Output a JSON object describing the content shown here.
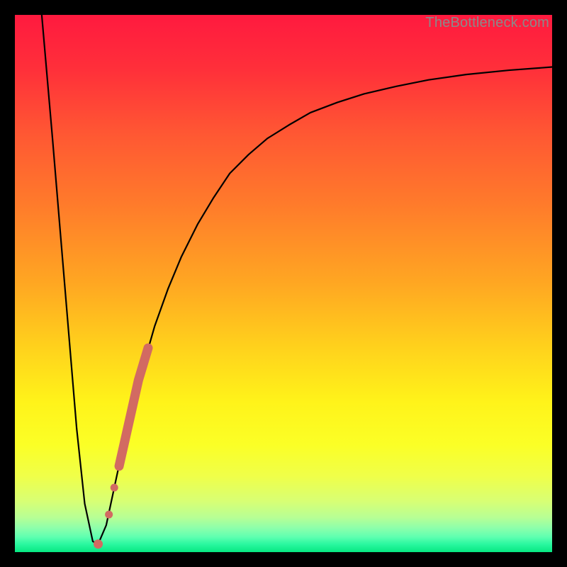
{
  "watermark": "TheBottleneck.com",
  "colors": {
    "frame": "#000000",
    "curve": "#000000",
    "markers": "#d26a62"
  },
  "gradient_stops": [
    {
      "offset": 0.0,
      "color": "#ff1a3f"
    },
    {
      "offset": 0.1,
      "color": "#ff2f3a"
    },
    {
      "offset": 0.22,
      "color": "#ff5733"
    },
    {
      "offset": 0.35,
      "color": "#ff7a2b"
    },
    {
      "offset": 0.5,
      "color": "#ffa722"
    },
    {
      "offset": 0.62,
      "color": "#ffd21c"
    },
    {
      "offset": 0.72,
      "color": "#fff31a"
    },
    {
      "offset": 0.8,
      "color": "#fbff26"
    },
    {
      "offset": 0.86,
      "color": "#efff4a"
    },
    {
      "offset": 0.905,
      "color": "#d8ff74"
    },
    {
      "offset": 0.935,
      "color": "#b8ff94"
    },
    {
      "offset": 0.955,
      "color": "#8dffab"
    },
    {
      "offset": 0.972,
      "color": "#5effb0"
    },
    {
      "offset": 0.985,
      "color": "#2bf8a0"
    },
    {
      "offset": 1.0,
      "color": "#06e882"
    }
  ],
  "chart_data": {
    "type": "line",
    "title": "",
    "xlabel": "",
    "ylabel": "",
    "xlim": [
      0,
      100
    ],
    "ylim": [
      0,
      100
    ],
    "series": [
      {
        "name": "bottleneck-curve",
        "x": [
          5,
          7,
          8.5,
          10,
          11.5,
          13,
          14.5,
          15.5,
          17,
          18.5,
          20,
          22,
          24,
          26,
          28.5,
          31,
          34,
          37,
          40,
          43.5,
          47,
          51,
          55,
          60,
          65,
          71,
          77,
          84,
          92,
          100
        ],
        "y": [
          100,
          77,
          59,
          41,
          23,
          9,
          2,
          1.5,
          5,
          12,
          19,
          27,
          35,
          42,
          49,
          55,
          61,
          66,
          70.5,
          74,
          77,
          79.5,
          81.8,
          83.7,
          85.3,
          86.7,
          87.9,
          88.9,
          89.7,
          90.3
        ]
      }
    ],
    "markers": [
      {
        "x": 15.5,
        "y": 1.5
      },
      {
        "x": 17.5,
        "y": 7.0
      },
      {
        "x": 18.5,
        "y": 12.0
      },
      {
        "x": 19.4,
        "y": 16.0
      },
      {
        "x": 20.3,
        "y": 20.0
      },
      {
        "x": 21.2,
        "y": 24.0
      },
      {
        "x": 22.1,
        "y": 28.0
      },
      {
        "x": 23.0,
        "y": 32.0
      },
      {
        "x": 23.9,
        "y": 35.0
      },
      {
        "x": 24.8,
        "y": 38.0
      }
    ]
  }
}
